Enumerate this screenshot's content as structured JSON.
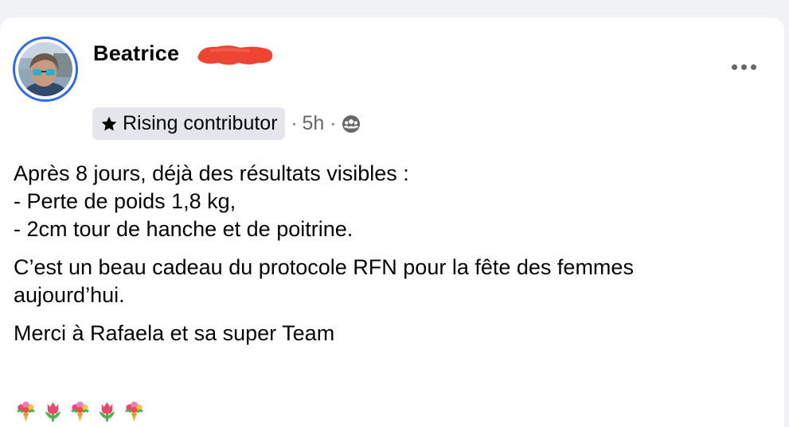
{
  "post": {
    "author_name": "Beatrice",
    "badge_label": "Rising contributor",
    "separator": "·",
    "time": "5h",
    "body": {
      "line1": "Après 8 jours,  déjà des résultats visibles :",
      "line2": "- Perte de poids 1,8 kg,",
      "line3": "- 2cm tour de hanche et de poitrine.",
      "paragraph2_line1": "C’est un beau cadeau du protocole RFN pour la fête des femmes",
      "paragraph2_line2": "aujourd’hui.",
      "paragraph3": "Merci à Rafaela et sa super Team"
    },
    "emojis": [
      "bouquet",
      "tulip",
      "bouquet",
      "tulip",
      "bouquet"
    ]
  },
  "icons": {
    "badge": "star-icon",
    "audience": "group-icon",
    "menu": "more-options-icon"
  },
  "colors": {
    "avatar_ring": "#2d6ae3",
    "redaction": "#ee4433",
    "secondary_text": "#65676b",
    "badge_bg": "#e4e6eb"
  }
}
